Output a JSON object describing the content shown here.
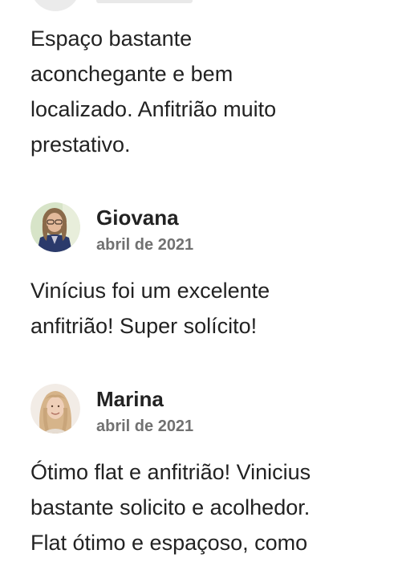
{
  "reviews": [
    {
      "text_lines": [
        "Espaço bastante",
        "aconchegante e bem",
        "localizado. Anfitrião muito",
        "prestativo."
      ]
    },
    {
      "name": "Giovana",
      "date": "abril de 2021",
      "text_lines": [
        "Vinícius foi um excelente",
        "anfitrião! Super solícito!"
      ]
    },
    {
      "name": "Marina",
      "date": "abril de 2021",
      "text_lines": [
        "Ótimo flat e anfitrião! Vinicius",
        "bastante solicito e acolhedor.",
        "Flat ótimo e espaçoso, como"
      ]
    }
  ],
  "colors": {
    "text": "#222222",
    "secondary_text": "#717171",
    "background": "#ffffff"
  },
  "icons": {
    "avatar_giovana": "user-avatar-photo",
    "avatar_marina": "user-avatar-photo"
  }
}
